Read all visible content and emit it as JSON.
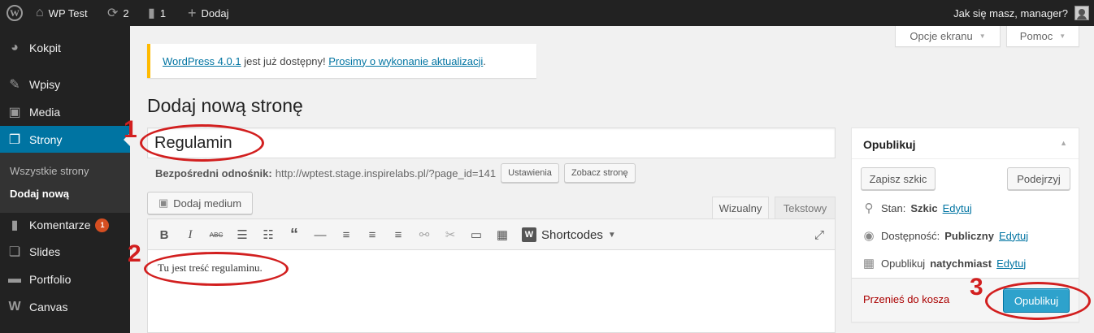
{
  "adminbar": {
    "site_name": "WP Test",
    "updates_count": "2",
    "comments_count": "1",
    "new_label": "Dodaj",
    "greeting": "Jak się masz, manager?"
  },
  "sidebar": {
    "items": [
      {
        "label": "Kokpit",
        "icon": "dashboard-icon"
      },
      {
        "label": "Wpisy",
        "icon": "pin-icon"
      },
      {
        "label": "Media",
        "icon": "media-icon"
      },
      {
        "label": "Strony",
        "icon": "pages-icon"
      },
      {
        "label": "Komentarze",
        "icon": "comments-icon",
        "badge": "1"
      },
      {
        "label": "Slides",
        "icon": "slides-icon"
      },
      {
        "label": "Portfolio",
        "icon": "portfolio-icon"
      },
      {
        "label": "Canvas",
        "icon": "canvas-icon"
      }
    ],
    "submenu": [
      "Wszystkie strony",
      "Dodaj nową"
    ]
  },
  "screen_options": {
    "options_label": "Opcje ekranu",
    "help_label": "Pomoc"
  },
  "notice": {
    "version_link": "WordPress 4.0.1",
    "text": " jest już dostępny! ",
    "update_link": "Prosimy o wykonanie aktualizacji",
    "end": "."
  },
  "page": {
    "title": "Dodaj nową stronę"
  },
  "editor": {
    "title_value": "Regulamin",
    "permalink_label": "Bezpośredni odnośnik:",
    "permalink_url": "http://wptest.stage.inspirelabs.pl/?page_id=141",
    "settings_button": "Ustawienia",
    "view_button": "Zobacz stronę",
    "add_media": "Dodaj medium",
    "tab_visual": "Wizualny",
    "tab_text": "Tekstowy",
    "shortcodes": "Shortcodes",
    "content": "Tu jest treść regulaminu."
  },
  "publish": {
    "title": "Opublikuj",
    "save_draft": "Zapisz szkic",
    "preview": "Podejrzyj",
    "status_label": "Stan:",
    "status_value": "Szkic",
    "visibility_label": "Dostępność:",
    "visibility_value": "Publiczny",
    "schedule_label": "Opublikuj",
    "schedule_value": "natychmiast",
    "edit_link": "Edytuj",
    "trash": "Przenieś do kosza",
    "publish_button": "Opublikuj"
  },
  "annotations": [
    "1",
    "2",
    "3"
  ],
  "colors": {
    "accent": "#0074a2",
    "publish_button": "#2ea2cc",
    "annotation": "#d21f1f",
    "notice_border": "#ffba00"
  }
}
